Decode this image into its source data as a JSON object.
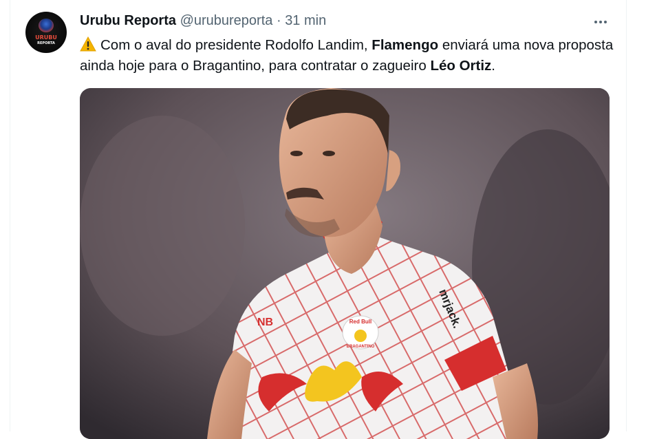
{
  "tweet": {
    "author_name": "Urubu Reporta",
    "handle": "@urubureporta",
    "separator": "·",
    "time": "31 min",
    "avatar_text": [
      "URUBU",
      "REPORTA"
    ],
    "text_parts": [
      "Com o aval do presidente Rodolfo Landim, ",
      "Flamengo",
      " enviará uma nova proposta ainda hoje para o Bragantino, para contratar o zagueiro ",
      "Léo Ortiz",
      "."
    ],
    "photo": {
      "shirt_sponsor": "mrjack.",
      "crest_text": [
        "Red Bull",
        "BRAGANTINO"
      ]
    }
  },
  "icons": {
    "more": "more-horizontal-icon",
    "warning": "warning-emoji-icon"
  },
  "colors": {
    "name": "#0f1419",
    "secondary": "#536471",
    "kit_red": "#d62e2e",
    "kit_yellow": "#f3c51f"
  }
}
